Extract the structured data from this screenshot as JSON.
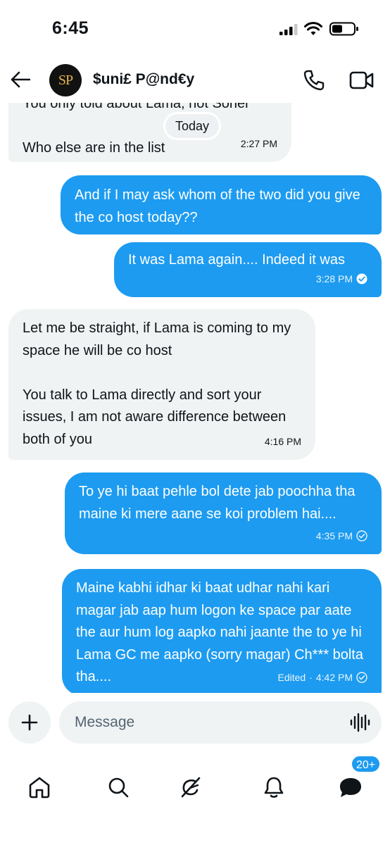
{
  "status_bar": {
    "time": "6:45"
  },
  "header": {
    "avatar_initials": "SP",
    "contact_name": "$uni£ P@nd€y"
  },
  "chat": {
    "day_separator": "Today",
    "messages": [
      {
        "direction": "in",
        "text": "You only told about Lama, not Sonel\n\nWho else are in the list",
        "time": "2:27 PM"
      },
      {
        "direction": "out",
        "text": "And if I may ask whom of the two did you give the co host today??",
        "time": ""
      },
      {
        "direction": "out",
        "text": "It was Lama again.... Indeed it was",
        "time": "3:28 PM",
        "status": "read"
      },
      {
        "direction": "in",
        "text": "Let me be straight, if Lama is coming to my space he will be co host\n\nYou talk to Lama directly and sort your issues, I am not aware difference between both of you",
        "time": "4:16 PM"
      },
      {
        "direction": "out",
        "text": "To ye hi baat pehle bol dete jab poochha tha maine ki mere aane se koi problem hai....",
        "time": "4:35 PM",
        "status": "sent"
      },
      {
        "direction": "out",
        "text": "Maine kabhi idhar ki baat udhar nahi kari magar jab aap hum logon ke space par aate the aur hum log aapko nahi jaante the to ye hi Lama GC me aapko (sorry magar) Ch*** bolta tha....",
        "edited_label": "Edited",
        "time": "4:42 PM",
        "status": "sent"
      }
    ]
  },
  "composer": {
    "placeholder": "Message",
    "value": ""
  },
  "bottom_nav": {
    "items": [
      "home-icon",
      "search-icon",
      "grok-icon",
      "notifications-icon",
      "messages-icon"
    ],
    "messages_badge": "20+"
  },
  "colors": {
    "accent": "#1d9bf0",
    "incoming_bubble": "#eff3f4",
    "text": "#0f1419"
  }
}
